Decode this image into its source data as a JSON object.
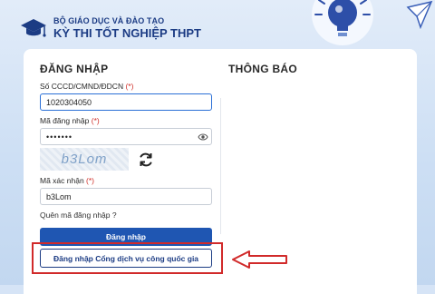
{
  "header": {
    "ministry": "BỘ GIÁO DỤC VÀ ĐÀO TẠO",
    "exam": "KỲ THI TỐT NGHIỆP THPT"
  },
  "login": {
    "title": "ĐĂNG NHẬP",
    "id_label": "Số CCCD/CMND/ĐDCN",
    "id_value": "1020304050",
    "password_label": "Mã đăng nhập",
    "password_value": "•••••••",
    "captcha_text": "b3Lom",
    "captcha_label": "Mã xác nhận",
    "captcha_value": "b3Lom",
    "required_mark": "(*)",
    "forgot": "Quên mã đăng nhập ?",
    "login_button": "Đăng nhập",
    "public_service_button": "Đăng nhập Cổng dịch vụ công quốc gia"
  },
  "notice": {
    "title": "THÔNG BÁO"
  },
  "colors": {
    "brand": "#1c3c84",
    "primary_button": "#1f56b2",
    "highlight": "#d12a2a"
  }
}
